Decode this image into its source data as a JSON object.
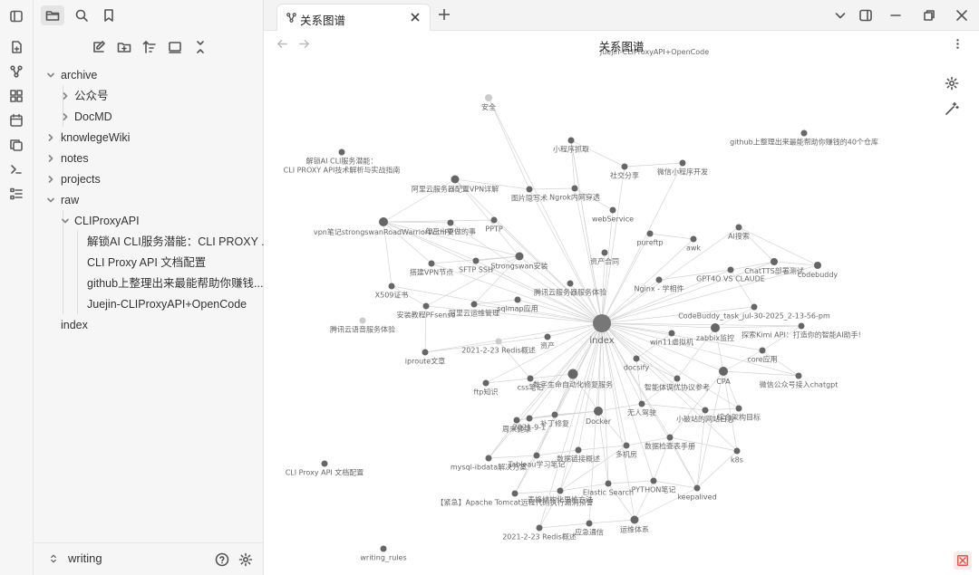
{
  "sidebar": {
    "tree": [
      {
        "label": "archive",
        "expanded": true
      },
      {
        "label": "公众号",
        "expanded": false
      },
      {
        "label": "DocMD",
        "expanded": false
      },
      {
        "label": "knowlegeWiki",
        "expanded": false
      },
      {
        "label": "notes",
        "expanded": false
      },
      {
        "label": "projects",
        "expanded": false
      },
      {
        "label": "raw",
        "expanded": true
      },
      {
        "label": "CLIProxyAPI",
        "expanded": true
      },
      {
        "label": "解锁AI CLI服务潜能：CLI PROXY ..."
      },
      {
        "label": "CLI Proxy API 文档配置"
      },
      {
        "label": "github上整理出来最能帮助你赚钱..."
      },
      {
        "label": "Juejin-CLIProxyAPI+OpenCode"
      },
      {
        "label": "index"
      }
    ],
    "vault_name": "writing"
  },
  "tab": {
    "label": "关系图谱"
  },
  "view": {
    "title": "关系图谱"
  },
  "graph": {
    "nodes": [
      {
        "label": "index",
        "size": "large"
      },
      {
        "label": "Juejin-CLIProxyAPI+OpenCode"
      },
      {
        "label": "安全"
      },
      {
        "label": "小程序抓取"
      },
      {
        "label": "github上整理出来最能帮助你赚钱的40个仓库"
      },
      {
        "label": "解锁AI CLI服务潜能：CLI PROXY API技术解析与实战指南"
      },
      {
        "label": "社交分享"
      },
      {
        "label": "微信小程序开发"
      },
      {
        "label": "阿里云服务器配置VPN详解"
      },
      {
        "label": "图片隐写术"
      },
      {
        "label": "Ngrok内网穿透"
      },
      {
        "label": "webService"
      },
      {
        "label": "vpn笔记strongswanRoadWarriorWithPP"
      },
      {
        "label": "PPTP"
      },
      {
        "label": "年三十要做的事"
      },
      {
        "label": "pureftp"
      },
      {
        "label": "awk"
      },
      {
        "label": "AI搜索"
      },
      {
        "label": "SFTP SSH"
      },
      {
        "label": "Strongswan安装"
      },
      {
        "label": "资产合同"
      },
      {
        "label": "ChatTTS部署测试"
      },
      {
        "label": "codebuddy"
      },
      {
        "label": "搭建VPN节点"
      },
      {
        "label": "GPT4O VS CLAUDE"
      },
      {
        "label": "Nginx - 学相件"
      },
      {
        "label": "X509证书"
      },
      {
        "label": "腾讯云服务器服务体验"
      },
      {
        "label": "阿里云运维管理"
      },
      {
        "label": "sqlmap应用"
      },
      {
        "label": "安装教程PFsense"
      },
      {
        "label": "CodeBuddy_task_jul-30-2025_2-13-56-pm"
      },
      {
        "label": "腾讯云语音服务体验"
      },
      {
        "label": "探索Kimi API：打造你的智能AI助手!"
      },
      {
        "label": "win11虚拟机"
      },
      {
        "label": "zabbix监控"
      },
      {
        "label": "2021-2-23 Redis概述"
      },
      {
        "label": "资产"
      },
      {
        "label": "iproute文章"
      },
      {
        "label": "core应用"
      },
      {
        "label": "docsify"
      },
      {
        "label": "ftp知识"
      },
      {
        "label": "css笔记"
      },
      {
        "label": "数字生命自动化修复服务"
      },
      {
        "label": "智能体调优协议参考"
      },
      {
        "label": "CPA"
      },
      {
        "label": "微信公众号接入chatgpt"
      },
      {
        "label": "无人驾驶"
      },
      {
        "label": "Docker"
      },
      {
        "label": "小破站的网站日志"
      },
      {
        "label": "综合架构目标"
      },
      {
        "label": "周末健康"
      },
      {
        "label": "补丁修复"
      },
      {
        "label": "2021-9-1"
      },
      {
        "label": "数据检查表手册"
      },
      {
        "label": "多机房"
      },
      {
        "label": "CLI Proxy API 文档配置"
      },
      {
        "label": "mysql-ibdata解决方案"
      },
      {
        "label": "Tableau学习笔记"
      },
      {
        "label": "数据链接概述"
      },
      {
        "label": "k8s"
      },
      {
        "label": "PYTHON笔记"
      },
      {
        "label": "Elastic Search"
      },
      {
        "label": "keepalived"
      },
      {
        "label": "【紧急】Apache Tomcat远程代码执行漏洞预警"
      },
      {
        "label": "表格结构化思维方法"
      },
      {
        "label": "2021-2-23 Redis概述 "
      },
      {
        "label": "应急通信"
      },
      {
        "label": "运维体系"
      },
      {
        "label": "writing_rules"
      }
    ]
  }
}
